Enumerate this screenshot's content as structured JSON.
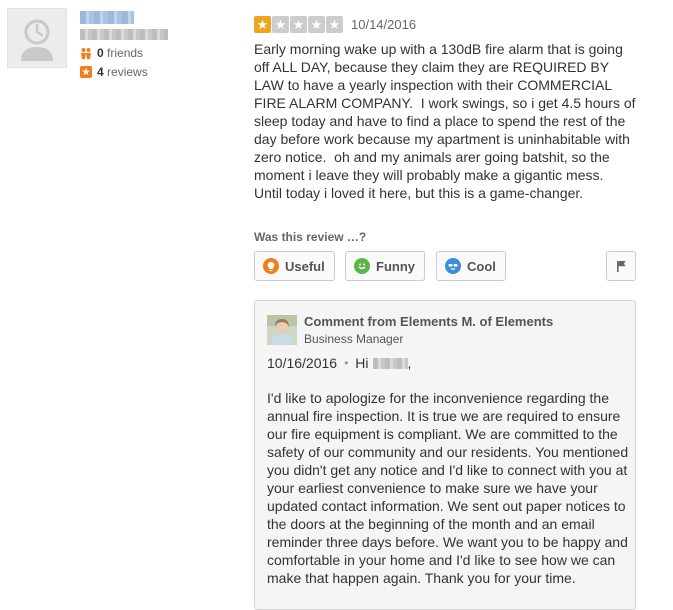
{
  "user": {
    "friends_count": "0",
    "friends_label": "friends",
    "reviews_count": "4",
    "reviews_label": "reviews"
  },
  "review": {
    "rating": 1,
    "max_rating": 5,
    "date": "10/14/2016",
    "text": "Early morning wake up with a 130dB fire alarm that is going off ALL DAY, because they claim they are REQUIRED BY LAW to have a yearly inspection with their COMMERCIAL FIRE ALARM COMPANY.  I work swings, so i get 4.5 hours of sleep today and have to find a place to spend the rest of the day before work because my apartment is uninhabitable with zero notice.  oh and my animals arer going batshit, so the moment i leave they will probably make a gigantic mess.  Until today i loved it here, but this is a game-changer."
  },
  "feedback": {
    "question": "Was this review …?",
    "useful_label": "Useful",
    "funny_label": "Funny",
    "cool_label": "Cool"
  },
  "comment": {
    "from": "Comment from Elements M. of Elements",
    "role": "Business Manager",
    "date": "10/16/2016",
    "greeting": "Hi",
    "text": "I'd like to apologize for the inconvenience regarding the annual fire inspection. It is true we are required to ensure our fire equipment is compliant. We are committed to the safety of our community and our residents. You mentioned you didn't get any notice and I'd like to connect with you at your earliest convenience to make sure we have your updated contact information. We sent out paper notices to the doors at the beginning of the month and an email reminder three days before. We want you to be happy and comfortable in your home and I'd like to see how we can make that happen again. Thank you for your time."
  },
  "colors": {
    "star_on": "#f0a520",
    "star_off": "#cccccc",
    "useful": "#f07f1a",
    "funny": "#5bb546",
    "cool": "#3a8fd8"
  }
}
